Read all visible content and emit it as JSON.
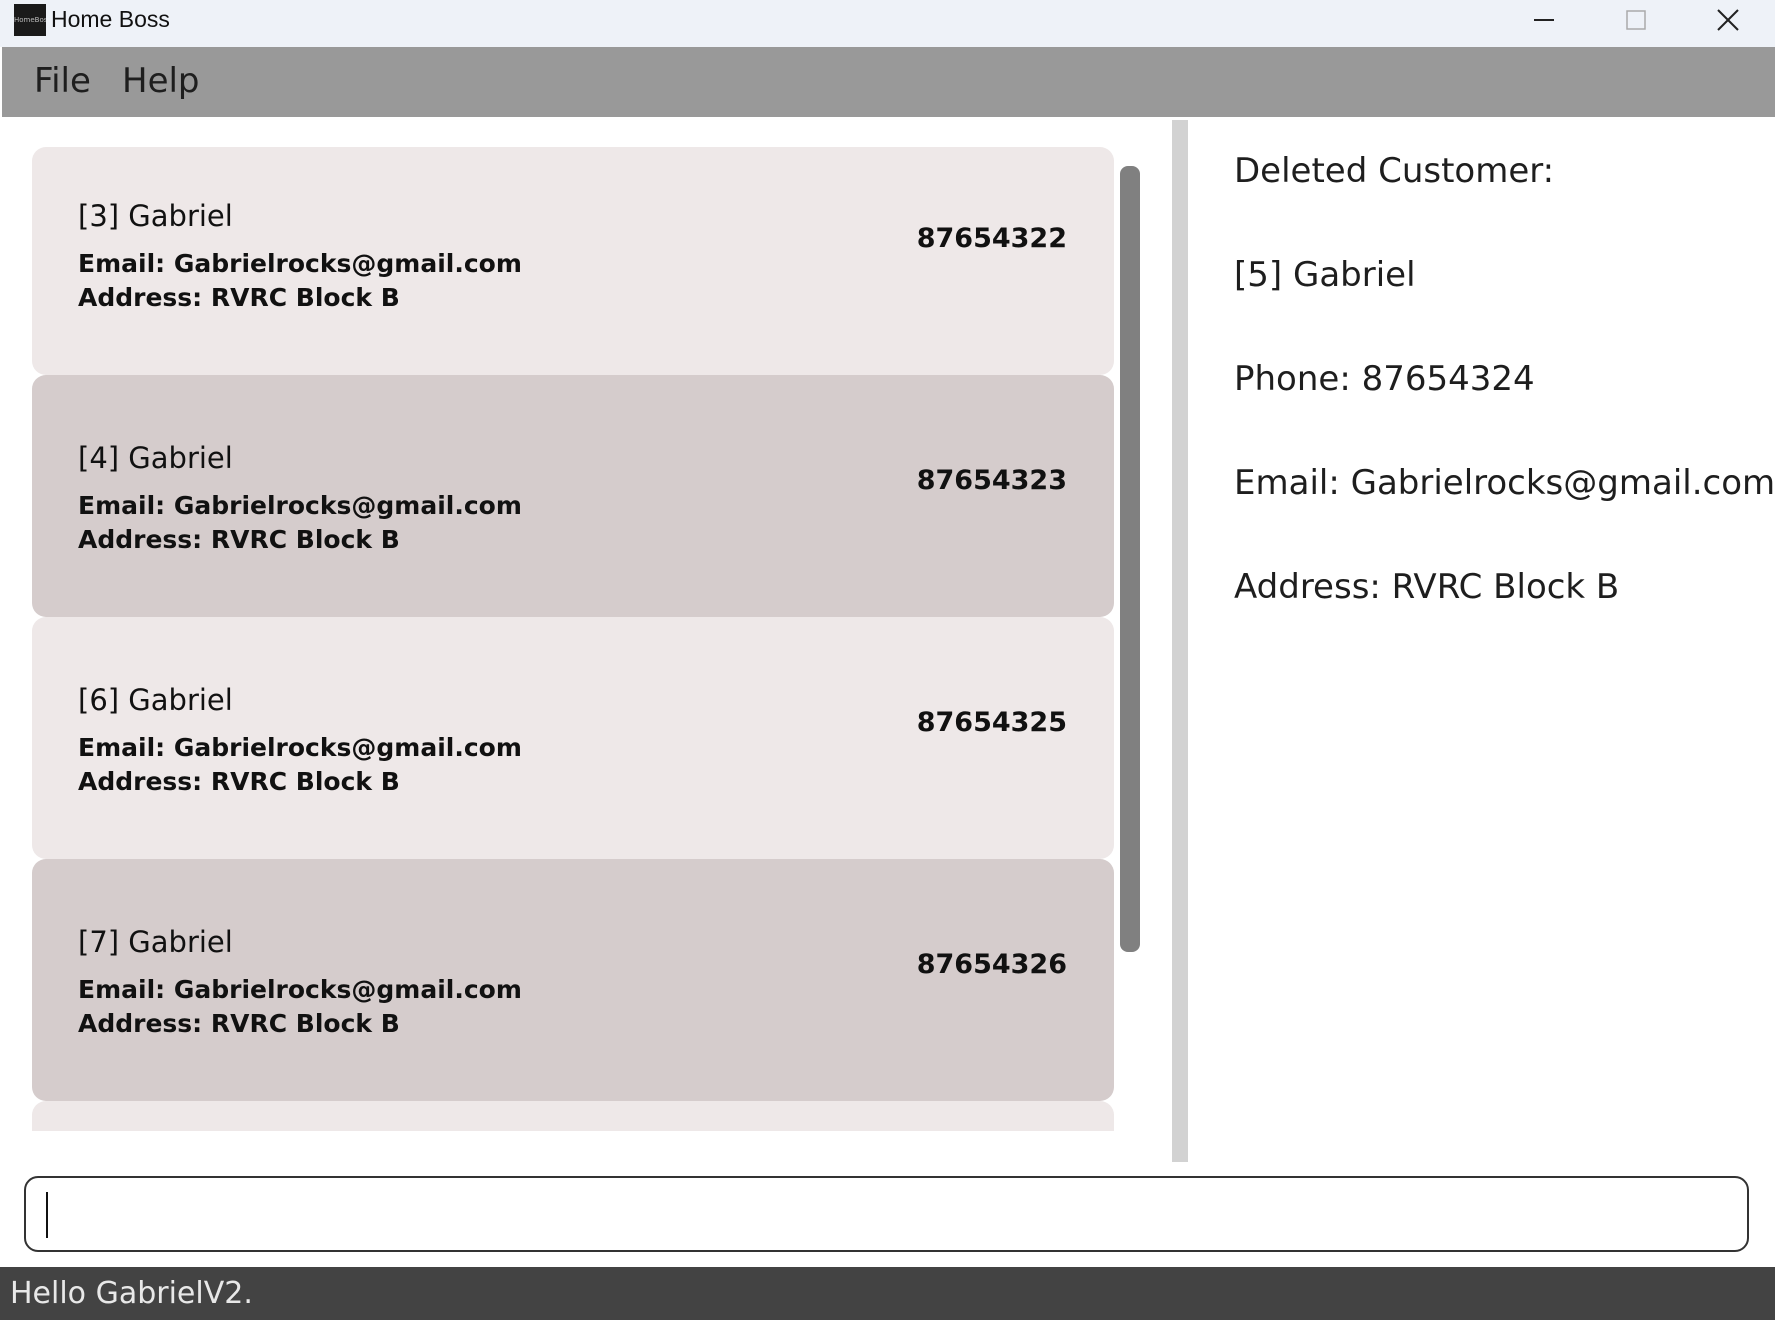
{
  "window": {
    "title": "Home Boss",
    "icon_text": "HomeBoss"
  },
  "menu": {
    "file": "File",
    "help": "Help"
  },
  "customers": [
    {
      "name": "[3] Gabriel",
      "phone": "87654322",
      "email": "Email: Gabrielrocks@gmail.com",
      "address": "Address: RVRC Block B"
    },
    {
      "name": "[4] Gabriel",
      "phone": "87654323",
      "email": "Email: Gabrielrocks@gmail.com",
      "address": "Address: RVRC Block B"
    },
    {
      "name": "[6] Gabriel",
      "phone": "87654325",
      "email": "Email: Gabrielrocks@gmail.com",
      "address": "Address: RVRC Block B"
    },
    {
      "name": "[7] Gabriel",
      "phone": "87654326",
      "email": "Email: Gabrielrocks@gmail.com",
      "address": "Address: RVRC Block B"
    }
  ],
  "result": {
    "heading": "Deleted Customer:",
    "name": "[5] Gabriel",
    "phone": "Phone: 87654324",
    "email": "Email: Gabrielrocks@gmail.com",
    "address": "Address: RVRC Block B"
  },
  "command": {
    "value": "",
    "placeholder": ""
  },
  "status": {
    "text": "Hello GabrielV2."
  },
  "colors": {
    "card_light": "#eee8e8",
    "card_dark": "#d5cccc",
    "menubar": "#999999",
    "statusbar": "#434343"
  }
}
